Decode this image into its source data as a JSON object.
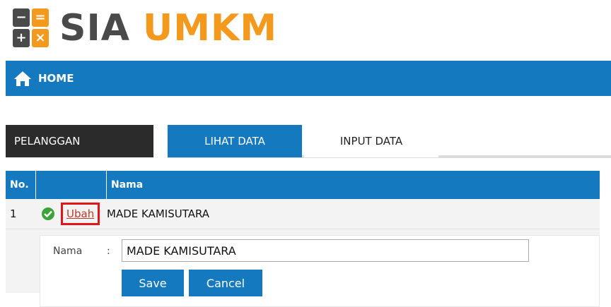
{
  "logo": {
    "text_sia": "SIA",
    "text_umkm": "UMKM",
    "icon_symbols": [
      "−",
      "=",
      "+",
      "×"
    ],
    "colors": {
      "dark": "#4a4a4a",
      "accent": "#f39a1e"
    }
  },
  "nav": {
    "home_label": "HOME",
    "icon": "home-icon"
  },
  "section": {
    "label": "PELANGGAN",
    "tabs": [
      {
        "label": "LIHAT DATA",
        "active": true
      },
      {
        "label": "INPUT DATA",
        "active": false
      }
    ]
  },
  "table": {
    "headers": {
      "no": "No.",
      "action": "",
      "nama": "Nama"
    },
    "rows": [
      {
        "no": "1",
        "action_label": "Ubah",
        "nama": "MADE KAMISUTARA"
      }
    ]
  },
  "edit_form": {
    "field_label": "Nama",
    "separator": ":",
    "field_value": "MADE KAMISUTARA",
    "save_label": "Save",
    "cancel_label": "Cancel"
  },
  "colors": {
    "primary": "#1479bf",
    "section_bg": "#2b2b2b",
    "highlight": "#e0161b",
    "success": "#3aa33a"
  }
}
